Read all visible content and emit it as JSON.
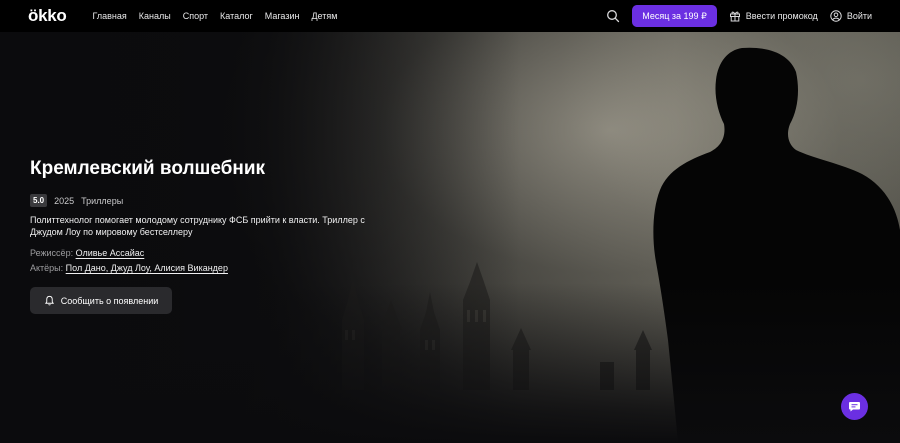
{
  "header": {
    "logo": "ökko",
    "nav": [
      "Главная",
      "Каналы",
      "Спорт",
      "Каталог",
      "Магазин",
      "Детям"
    ],
    "subscribe_label": "Месяц за 199 ₽",
    "promo_label": "Ввести промокод",
    "login_label": "Войти"
  },
  "movie": {
    "title": "Кремлевский волшебник",
    "rating": "5.0",
    "year": "2025",
    "genre": "Триллеры",
    "description": "Политтехнолог помогает молодому сотруднику ФСБ прийти к власти. Триллер с Джудом Лоу по мировому бестселлеру",
    "director_label": "Режиссёр:",
    "director": "Оливье Ассайас",
    "actors_label": "Актёры:",
    "actors": "Пол Дано, Джуд Лоу, Алисия Викандер",
    "notify_label": "Сообщить о появлении"
  },
  "colors": {
    "accent": "#6b2fe2",
    "background": "#0b0b0d",
    "button_dark": "#2a2a2d"
  },
  "icons": [
    "search-icon",
    "gift-icon",
    "user-icon",
    "bell-icon",
    "chat-icon"
  ]
}
